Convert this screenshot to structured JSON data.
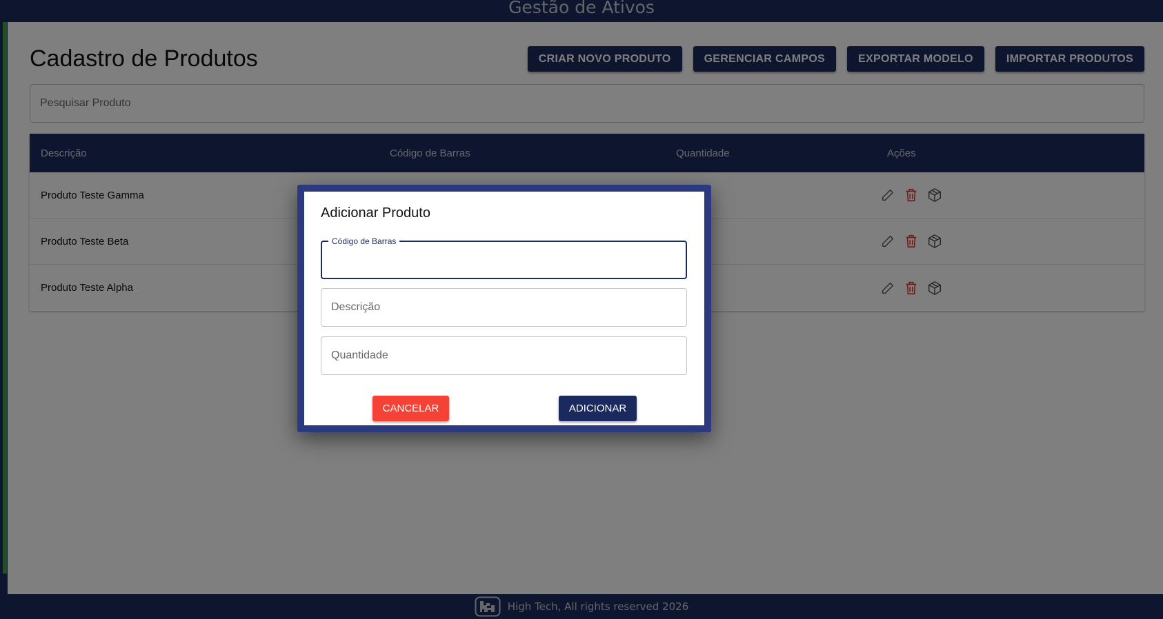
{
  "header": {
    "title": "Gestão de Ativos"
  },
  "page": {
    "title": "Cadastro de Produtos"
  },
  "toolbar": {
    "create_label": "CRIAR NOVO PRODUTO",
    "manage_fields_label": "GERENCIAR CAMPOS",
    "export_label": "EXPORTAR MODELO",
    "import_label": "IMPORTAR PRODUTOS"
  },
  "search": {
    "placeholder": "Pesquisar Produto",
    "value": ""
  },
  "table": {
    "columns": [
      "Descrição",
      "Código de Barras",
      "Quantidade",
      "Ações"
    ],
    "rows": [
      {
        "descricao": "Produto Teste Gamma"
      },
      {
        "descricao": "Produto Teste Beta"
      },
      {
        "descricao": "Produto Teste Alpha"
      }
    ],
    "row_actions": [
      "edit-icon",
      "delete-icon",
      "box-icon"
    ]
  },
  "modal": {
    "title": "Adicionar Produto",
    "barcode": {
      "label": "Código de Barras",
      "value": ""
    },
    "description": {
      "placeholder": "Descrição",
      "value": ""
    },
    "quantity": {
      "placeholder": "Quantidade",
      "value": ""
    },
    "cancel_label": "CANCELAR",
    "add_label": "ADICIONAR"
  },
  "footer": {
    "text": "High Tech, All rights reserved 2026"
  },
  "colors": {
    "primary": "#1b2a5e",
    "modal_border": "#2b3a7f",
    "danger": "#f44336",
    "accent_green": "#43a047"
  }
}
